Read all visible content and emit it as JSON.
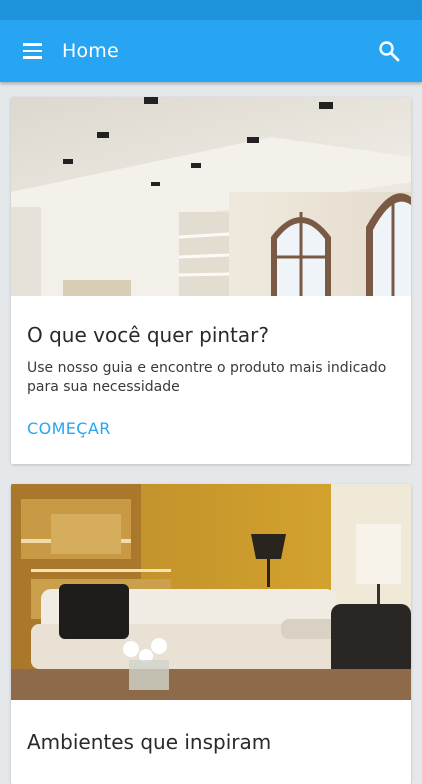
{
  "app_bar": {
    "title": "Home",
    "menu_icon": "hamburger-menu-icon",
    "search_icon": "search-icon",
    "color": "#27a5f2"
  },
  "cards": [
    {
      "image": "bright-room-ceiling-photo",
      "title": "O que você quer pintar?",
      "description": "Use nosso guia e encontre o produto mais indicado para sua necessidade",
      "action_label": "COMEÇAR"
    },
    {
      "image": "yellow-living-room-photo",
      "title": "Ambientes que inspiram"
    }
  ]
}
